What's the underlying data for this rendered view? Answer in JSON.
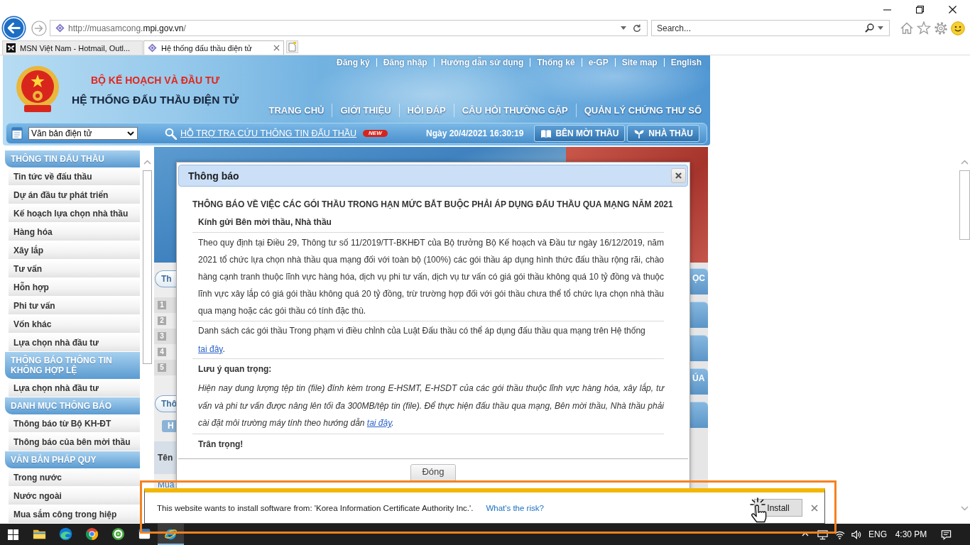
{
  "browser": {
    "address": {
      "url_parts": [
        {
          "text": "http://muasamcong.",
          "highlight": false
        },
        {
          "text": "mpi.gov.vn",
          "highlight": true
        },
        {
          "text": "/",
          "highlight": false
        }
      ]
    },
    "search": {
      "placeholder": "Search..."
    },
    "tabs": [
      {
        "label": "MSN Việt Nam - Hotmail, Outl...",
        "selected": false
      },
      {
        "label": "Hệ thống đấu thầu điện tử",
        "selected": true
      }
    ]
  },
  "site_header": {
    "ministry": "BỘ KẾ HOẠCH VÀ ĐẦU TƯ",
    "system_name": "HỆ THỐNG ĐẤU THẦU ĐIỆN TỬ",
    "top_links": [
      "Đăng ký",
      "Đăng nhập",
      "Hướng dẫn sử dụng",
      "Thống kê",
      "e-GP",
      "Site map",
      "English"
    ],
    "nav": [
      "TRANG CHỦ",
      "GIỚI THIỆU",
      "HỎI ĐÁP",
      "CÂU HỎI THƯỜNG GẶP",
      "QUẢN LÝ CHỨNG THƯ SỐ"
    ],
    "document_select": {
      "value": "Văn bản điện tử"
    },
    "lookup_link": "HỖ TRỢ TRA CỨU THÔNG TIN ĐẤU THẦU",
    "new_badge": "NEW",
    "datetime": "Ngày 20/4/2021 16:30:19",
    "role_buttons": [
      "BÊN MỜI THẦU",
      "NHÀ THẦU"
    ]
  },
  "sidebar": {
    "sections": [
      {
        "title": "THÔNG TIN ĐẤU THẦU",
        "items": [
          "Tin tức về đấu thầu",
          "Dự án đầu tư phát triển",
          "Kế hoạch lựa chọn nhà thầu",
          "Hàng hóa",
          "Xây lắp",
          "Tư vấn",
          "Hỗn hợp",
          "Phi tư vấn",
          "Vốn khác",
          "Lựa chọn nhà đầu tư"
        ]
      },
      {
        "title": "THÔNG BÁO THÔNG TIN KHÔNG HỢP LỆ",
        "items": [
          "Lựa chọn nhà đầu tư"
        ]
      },
      {
        "title": "DANH MỤC THÔNG BÁO",
        "items": [
          "Thông báo từ Bộ KH-ĐT",
          "Thông báo của bên mời thầu"
        ]
      },
      {
        "title": "VĂN BẢN PHÁP QUY",
        "items": [
          "Trong nước",
          "Nước ngoài",
          "Mua sắm công trong hiệp"
        ]
      }
    ]
  },
  "page_behind": {
    "section_tabs": [
      "Th",
      "Thô"
    ],
    "row_numbers": [
      "1",
      "2",
      "3",
      "4",
      "5"
    ],
    "button_fragment": "H",
    "column_fragment": "Tên",
    "link_fragment": "Mua",
    "side_tabs": [
      {
        "kind": "labelled",
        "label": "ỌC"
      },
      {
        "kind": "blank"
      },
      {
        "kind": "blank"
      },
      {
        "kind": "labelled",
        "label": "ÚA"
      },
      {
        "kind": "blank"
      }
    ]
  },
  "dialog": {
    "title": "Thông báo",
    "heading": "THÔNG BÁO VỀ VIỆC CÁC GÓI THẦU TRONG HẠN MỨC BẮT BUỘC PHẢI ÁP DỤNG ĐẤU THẦU QUA MẠNG NĂM 2021",
    "greeting": "Kính gửi Bên mời thầu, Nhà thầu",
    "paragraph": "Theo quy định tại Điều 29, Thông tư số 11/2019/TT-BKHĐT của Bộ trưởng Bộ Kế hoạch và Đầu tư ngày 16/12/2019, năm 2021 tổ chức lựa chọn nhà thầu qua mạng đối với toàn bộ (100%) các gói thầu áp dụng hình thức đấu thầu rộng rãi, chào hàng cạnh tranh thuộc lĩnh vực hàng hóa, dịch vụ phi tư vấn, dịch vụ tư vấn có giá gói thầu không quá 10 tỷ đồng và thuộc lĩnh vực xây lắp có giá gói thầu không quá 20 tỷ đồng, trừ trường hợp đối với gói thầu chưa thể tổ chức lựa chọn nhà thầu qua mạng hoặc các gói thầu có tính đặc thù.",
    "list_notice": {
      "text": "Danh sách các gói thầu Trong phạm vi điều chỉnh của Luật Đấu thầu có thể áp dụng đấu thầu qua mạng trên Hệ thống",
      "link": "tai đây",
      "after": "."
    },
    "important_label": "Lưu ý quan trọng:",
    "important_notice": {
      "text": "Hiện nay dung lượng tệp tin (file) đính kèm trong E-HSMT, E-HSDT của các gói thầu thuộc lĩnh vực hàng hóa, xây lắp, tư vấn và phi tư vấn được nâng lên tối đa 300MB/tệp tin (file). Để thực hiện đấu thầu qua mạng, Bên mời thầu, Nhà thầu phải cài đặt môi trường máy tính theo hướng dẫn",
      "link": "tai đây",
      "after": "."
    },
    "closing": "Trân trọng!",
    "close_button": "Đóng"
  },
  "install_bar": {
    "message": "This website wants to install software from: 'Korea Information Certificate Authority Inc.'.",
    "risk_link": "What's the risk?",
    "install_button": "Install"
  },
  "taskbar": {
    "apps": [
      {
        "selected": false
      },
      {
        "selected": false
      },
      {
        "selected": false
      },
      {
        "selected": false
      },
      {
        "selected": false
      },
      {
        "selected": true
      }
    ],
    "language": "ENG",
    "time": "4:30 PM"
  }
}
